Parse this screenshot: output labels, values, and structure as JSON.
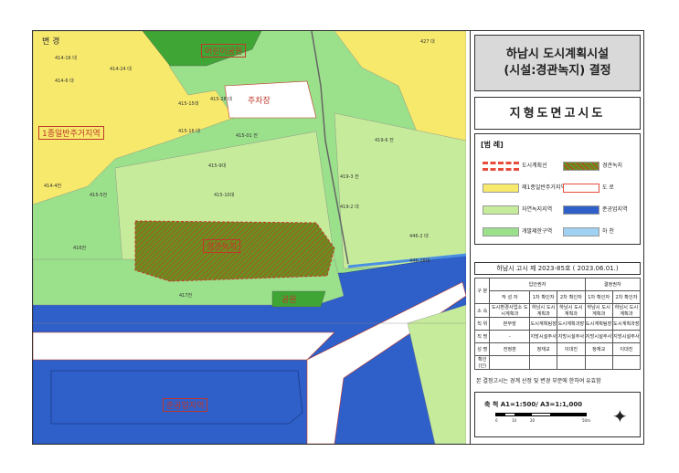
{
  "title": {
    "line1": "하남시 도시계획시설",
    "line2": "(시설:경관녹지) 결정"
  },
  "subtitle": "지형도면고시도",
  "legend": {
    "title": "[범 례]",
    "items": [
      {
        "label": "도시계획선",
        "color": "#ffffff",
        "border": "#e74c3c",
        "pattern": "dash"
      },
      {
        "label": "경관녹지",
        "color": "#6b7f1f",
        "border": "#c0392b",
        "pattern": "hatch"
      },
      {
        "label": "제1종일반주거지역",
        "color": "#f7e96c",
        "border": "#999",
        "pattern": "solid"
      },
      {
        "label": "도 로",
        "color": "#ffffff",
        "border": "#e74c3c",
        "pattern": "solid"
      },
      {
        "label": "자연녹지지역",
        "color": "#c6ec9b",
        "border": "#999",
        "pattern": "solid"
      },
      {
        "label": "준공업지역",
        "color": "#2f5fc8",
        "border": "#999",
        "pattern": "solid"
      },
      {
        "label": "개발제한구역",
        "color": "#9be08b",
        "border": "#999",
        "pattern": "solid"
      },
      {
        "label": "하 천",
        "color": "#9ed1f2",
        "border": "#999",
        "pattern": "solid"
      }
    ]
  },
  "notice": "하남시 고시 제 2023-85호 ( 2023.06.01.)",
  "sig_table": {
    "group_headers": {
      "left": "입안권자",
      "right": "결정권자"
    },
    "row_header_col": "구 분",
    "cols": [
      "작 성 자",
      "1차 확인자",
      "2차 확인자",
      "1차 확인자",
      "2차 확인자"
    ],
    "rows": [
      {
        "head": "소 속",
        "cells": [
          "도시환경사업소 도시계획과",
          "하남시 도시계획과",
          "하남시 도시계획과",
          "하남시 도시계획과",
          "하남시 도시계획과"
        ]
      },
      {
        "head": "직 위",
        "cells": [
          "본부장",
          "도시계획팀장",
          "도시계획과장",
          "도시계획팀장",
          "도시계획과장"
        ]
      },
      {
        "head": "직 명",
        "cells": [
          "-",
          "지방시설주사",
          "지방시설주사",
          "지방시설주사",
          "지방시설주사"
        ]
      },
      {
        "head": "성 명",
        "cells": [
          "전정훈",
          "정재교",
          "이대진",
          "정재교",
          "이대진"
        ]
      },
      {
        "head": "확인(인)",
        "cells": [
          "",
          "",
          "",
          "",
          ""
        ]
      }
    ]
  },
  "remark": "본 결정고시는 경계 산정 및 변경 부분에 한하여 유효함",
  "scale": {
    "label": "축 척 A1=1:500/ A3=1:1,000",
    "ticks": [
      "0",
      "10",
      "20",
      "",
      "50m"
    ]
  },
  "map": {
    "labels": {
      "park": "어린이공원",
      "parking": "주차장",
      "residential": "1종일반주거지역",
      "greenbelt": "경관녹지",
      "park2": "공원",
      "industrial": "준공업지역",
      "corner": "변 경",
      "circle1": "1",
      "circle2": "2",
      "circle3": "3"
    },
    "parcels": [
      "414-16 대",
      "414-6 대",
      "414-24 대",
      "415-15대",
      "415-16 대",
      "415-13 대",
      "415-28 대",
      "415-01 전",
      "415-9대",
      "415-10대",
      "415-5전",
      "416전",
      "417전",
      "418-2 답",
      "419-6 전",
      "419-3 전",
      "419-2 대",
      "427 대",
      "419-13 대",
      "413-1 대",
      "446-2 대",
      "446-28대",
      "431대",
      "414-4전",
      "415-4대"
    ],
    "colors": {
      "yellow": "#f7e96c",
      "green_light": "#c6ec9b",
      "green": "#9be08b",
      "green_dark": "#3fa535",
      "blue": "#2f5fc8",
      "road": "#ffffff"
    }
  }
}
